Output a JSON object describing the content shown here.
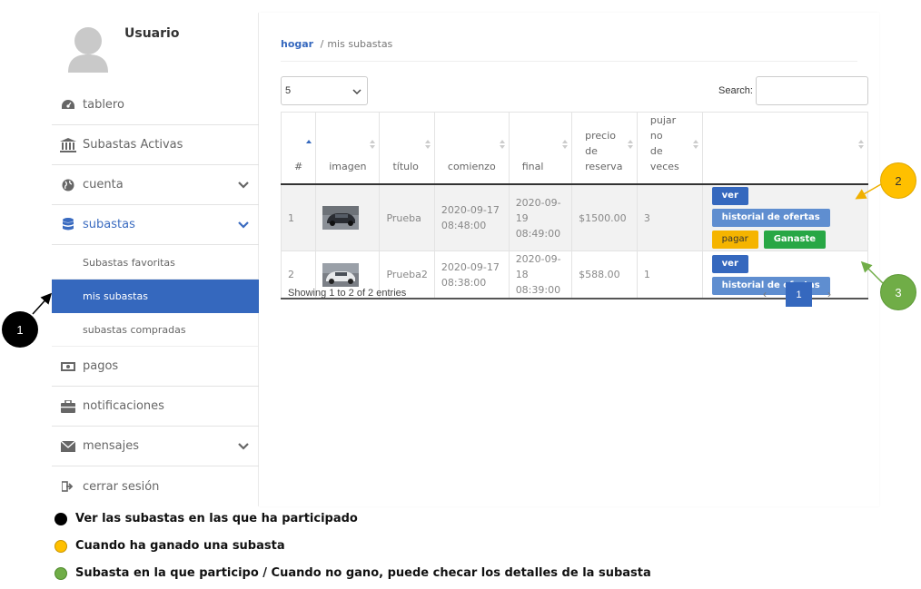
{
  "sidebar": {
    "username": "Usuario",
    "items": [
      {
        "label": "tablero",
        "icon": "dashboard-icon"
      },
      {
        "label": "Subastas Activas",
        "icon": "bank-icon"
      },
      {
        "label": "cuenta",
        "icon": "globe-icon"
      },
      {
        "label": "subastas",
        "icon": "database-icon"
      },
      {
        "label": "pagos",
        "icon": "money-icon"
      },
      {
        "label": "notificaciones",
        "icon": "briefcase-icon"
      },
      {
        "label": "mensajes",
        "icon": "envelope-icon"
      },
      {
        "label": "cerrar sesión",
        "icon": "sign-out-icon"
      }
    ],
    "subitems": [
      "Subastas favoritas",
      "mis subastas",
      "subastas compradas"
    ]
  },
  "breadcrumb": {
    "home": "hogar",
    "separator": "/",
    "current": "mis subastas"
  },
  "table_controls": {
    "page_length": "5",
    "search_label": "Search:",
    "search_value": ""
  },
  "table": {
    "headers": [
      "#",
      "imagen",
      "título",
      "comienzo",
      "final",
      "precio de reserva",
      "pujar no de veces",
      ""
    ],
    "header_lines": {
      "precio": [
        "precio",
        "de",
        "reserva"
      ],
      "pujar": [
        "pujar no",
        "de veces"
      ]
    },
    "rows": [
      {
        "num": "1",
        "title": "Prueba",
        "start_date": "2020-09-17",
        "start_time": "08:48:00",
        "end_date": "2020-09-19",
        "end_time": "08:49:00",
        "price": "$1500.00",
        "bids": "3"
      },
      {
        "num": "2",
        "title": "Prueba2",
        "start_date": "2020-09-17",
        "start_time": "08:38:00",
        "end_date": "2020-09-18",
        "end_time": "08:39:00",
        "price": "$588.00",
        "bids": "1"
      }
    ],
    "buttons": {
      "view": "ver",
      "history": "historial de ofertas",
      "pay": "pagar",
      "won": "Ganaste"
    }
  },
  "footer": {
    "info": "Showing 1 to 2 of 2 entries",
    "prev": "‹",
    "page": "1",
    "next": "›"
  },
  "annotations": {
    "one": "1",
    "two": "2",
    "three": "3"
  },
  "legend": [
    {
      "text": "Ver las subastas en las que ha participado",
      "color": "#000000"
    },
    {
      "text": "Cuando ha ganado una subasta",
      "color": "#FFC000"
    },
    {
      "text": "Subasta en la que participo / Cuando no gano, puede checar los detalles de la subasta",
      "color": "#70AD47"
    }
  ],
  "colors": {
    "primary": "#3568be",
    "history_button": "#5f8ed0",
    "pay_button": "#f5b400",
    "won_button": "#28a745"
  }
}
